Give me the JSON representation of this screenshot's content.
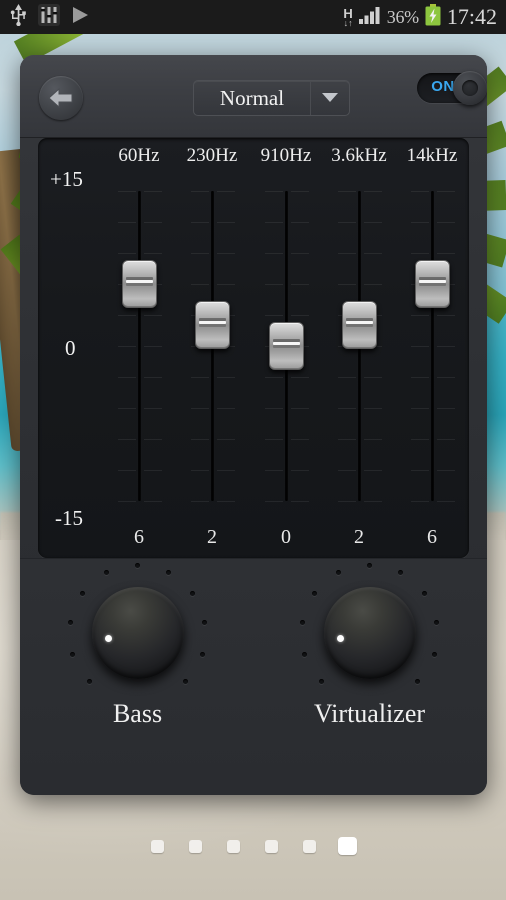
{
  "statusbar": {
    "icons_left": [
      "usb-icon",
      "equalizer-app-icon",
      "play-icon"
    ],
    "network_type": "H",
    "network_arrows": "↓↑",
    "signal_icon": "signal-bars-icon",
    "battery_percent": "36%",
    "battery_icon": "battery-charging-icon",
    "clock": "17:42"
  },
  "header": {
    "back_label": "back-arrow-icon",
    "preset": "Normal",
    "preset_arrow": "chevron-down-icon",
    "toggle_label": "ON",
    "toggle_state": "on"
  },
  "equalizer": {
    "axis": {
      "top": "+15",
      "mid": "0",
      "bottom": "-15"
    },
    "bands": [
      {
        "freq": "60Hz",
        "value": "6"
      },
      {
        "freq": "230Hz",
        "value": "2"
      },
      {
        "freq": "910Hz",
        "value": "0"
      },
      {
        "freq": "3.6kHz",
        "value": "2"
      },
      {
        "freq": "14kHz",
        "value": "6"
      }
    ]
  },
  "knobs": [
    {
      "name": "Bass"
    },
    {
      "name": "Virtualizer"
    }
  ],
  "pager": {
    "count": 6,
    "active_index": 5
  },
  "colors": {
    "accent_on": "#3aa8f0",
    "panel_bg": "#2e3034",
    "eq_bg": "#17191c",
    "text": "#f0f0f0",
    "thumb": "#c9c9c9"
  }
}
